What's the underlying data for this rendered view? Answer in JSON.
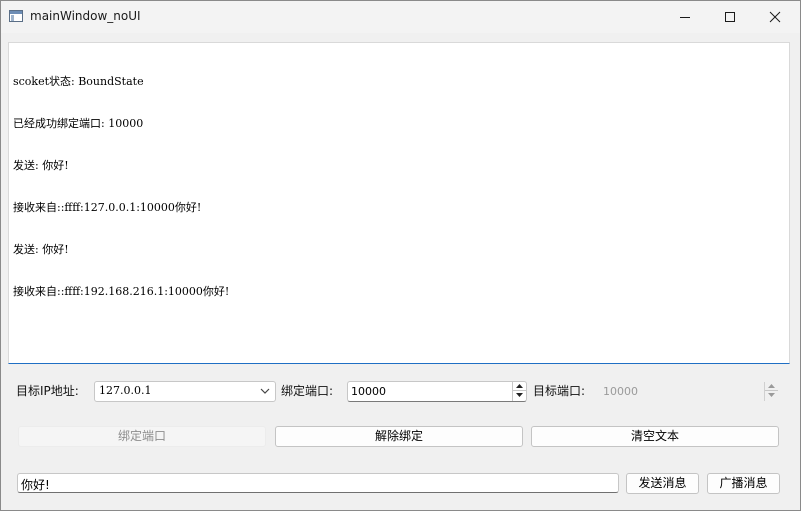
{
  "window": {
    "title": "mainWindow_noUI"
  },
  "log": {
    "lines": [
      "scoket状态: BoundState",
      "已经成功绑定端口: 10000",
      "发送: 你好!",
      "接收来自::ffff:127.0.0.1:10000你好!",
      "发送: 你好!",
      "接收来自::ffff:192.168.216.1:10000你好!"
    ]
  },
  "controls": {
    "target_ip_label": "目标IP地址:",
    "target_ip_value": "127.0.0.1",
    "bind_port_label": "绑定端口:",
    "bind_port_value": "10000",
    "target_port_label": "目标端口:",
    "target_port_value": "10000"
  },
  "buttons": {
    "bind": "绑定端口",
    "unbind": "解除绑定",
    "clear": "清空文本",
    "send": "发送消息",
    "broadcast": "广播消息"
  },
  "message": {
    "value": "你好!"
  },
  "icons": {
    "app": "window-app-icon",
    "minimize": "minimize-icon",
    "maximize": "maximize-icon",
    "close": "close-icon",
    "dropdown": "chevron-down-icon",
    "spin_up": "spin-up-icon",
    "spin_down": "spin-down-icon"
  },
  "colors": {
    "focus_accent": "#1f6fc4",
    "window_bg": "#f0f0f0",
    "disabled_text": "#8d8d8d"
  }
}
